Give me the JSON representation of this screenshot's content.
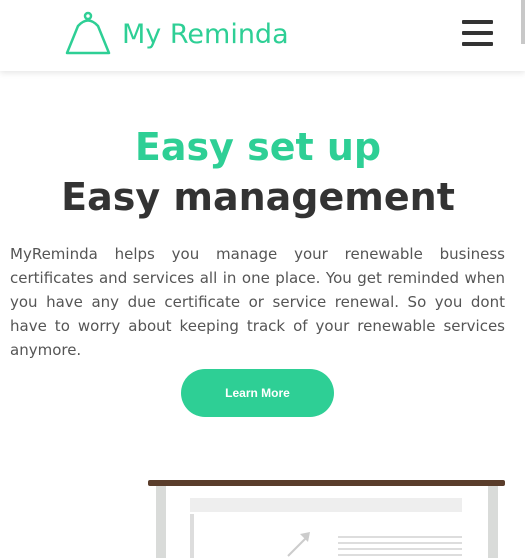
{
  "brand": {
    "name": "My Reminda",
    "icon": "bell-icon"
  },
  "nav": {
    "menu_icon": "hamburger-menu-icon"
  },
  "hero": {
    "title_line1": "Easy set up",
    "title_line2": "Easy management",
    "description": "MyReminda helps you manage your renewable business certificates and services all in one place. You get reminded when you have any due certificate or service renewal. So you dont have to worry about keeping track of your renewable services anymore.",
    "cta_label": "Learn More"
  },
  "colors": {
    "accent": "#2ecf95",
    "text_dark": "#333333",
    "text_body": "#555555",
    "illustration_frame": "#5a3d2b"
  }
}
